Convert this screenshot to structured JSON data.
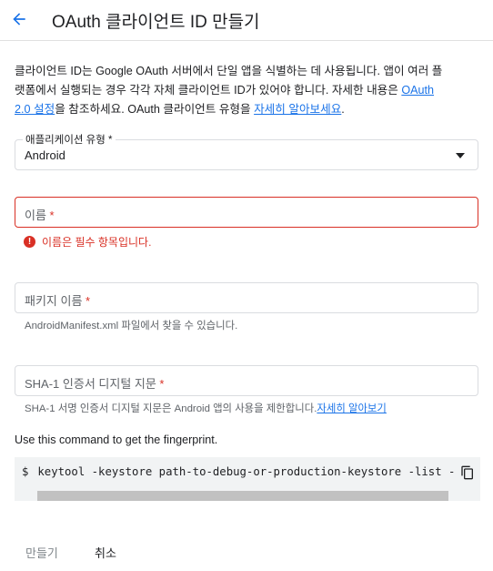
{
  "header": {
    "title": "OAuth 클라이언트 ID 만들기",
    "back_icon": "arrow-back-icon"
  },
  "description": {
    "line1": "클라이언트 ID는 Google OAuth 서버에서 단일 앱을 식별하는 데 사용됩니다. 앱이 여러 플",
    "line2_a": "랫폼에서 실행되는 경우 각각 자체 클라이언트 ID가 있어야 합니다. 자세한 내용은 ",
    "line2_link": "OAuth",
    "line3_link": "2.0 설정",
    "line3_b": "을 참조하세요. OAuth 클라이언트 유형을 ",
    "line3_link2": "자세히 알아보세요",
    "line3_c": "."
  },
  "app_type": {
    "label": "애플리케이션 유형 *",
    "value": "Android"
  },
  "name_field": {
    "placeholder": "이름",
    "required_mark": " *",
    "error": "이름은 필수 항목입니다."
  },
  "package_field": {
    "placeholder": "패키지 이름",
    "required_mark": " *",
    "help": "AndroidManifest.xml 파일에서 찾을 수 있습니다."
  },
  "sha_field": {
    "placeholder": "SHA-1 인증서 디지털 지문",
    "required_mark": " *",
    "help": "SHA-1 서명 인증서 디지털 지문은 Android 앱의 사용을 제한합니다.",
    "help_link": "자세히 알아보기"
  },
  "command": {
    "title": "Use this command to get the fingerprint.",
    "prompt": "$",
    "text": "keytool -keystore path-to-debug-or-production-keystore -list -v"
  },
  "actions": {
    "create": "만들기",
    "cancel": "취소"
  },
  "colors": {
    "accent": "#1a73e8",
    "error": "#d93025"
  }
}
